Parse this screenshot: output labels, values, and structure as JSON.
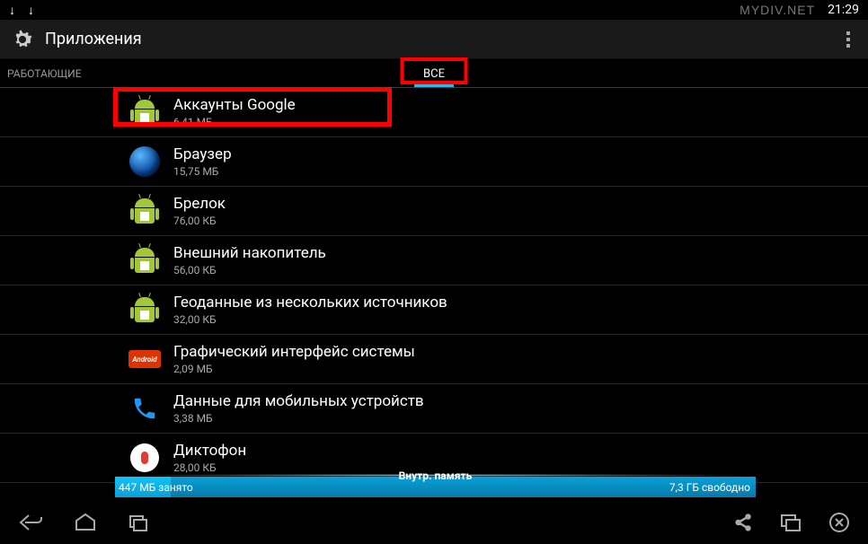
{
  "statusbar": {
    "watermark": "MYDIV.NET",
    "clock": "21:29"
  },
  "header": {
    "title": "Приложения"
  },
  "tabs": {
    "left": "РАБОТАЮЩИЕ",
    "center": "ВСЕ"
  },
  "apps": [
    {
      "name": "Аккаунты Google",
      "size": "6,41 МБ",
      "icon": "droid"
    },
    {
      "name": "Браузер",
      "size": "15,75 МБ",
      "icon": "globe"
    },
    {
      "name": "Брелок",
      "size": "76,00 КБ",
      "icon": "droid"
    },
    {
      "name": "Внешний накопитель",
      "size": "56,00 КБ",
      "icon": "droid"
    },
    {
      "name": "Геоданные из нескольких источников",
      "size": "32,00 КБ",
      "icon": "droid"
    },
    {
      "name": "Графический интерфейс системы",
      "size": "2,09 МБ",
      "icon": "kitkat"
    },
    {
      "name": "Данные для мобильных устройств",
      "size": "3,38 МБ",
      "icon": "phone"
    },
    {
      "name": "Диктофон",
      "size": "28,00 КБ",
      "icon": "mic"
    }
  ],
  "storage": {
    "used": "447 МБ занято",
    "label": "Внутр. память",
    "free": "7,3 ГБ свободно"
  },
  "kitkat_label": "Android"
}
